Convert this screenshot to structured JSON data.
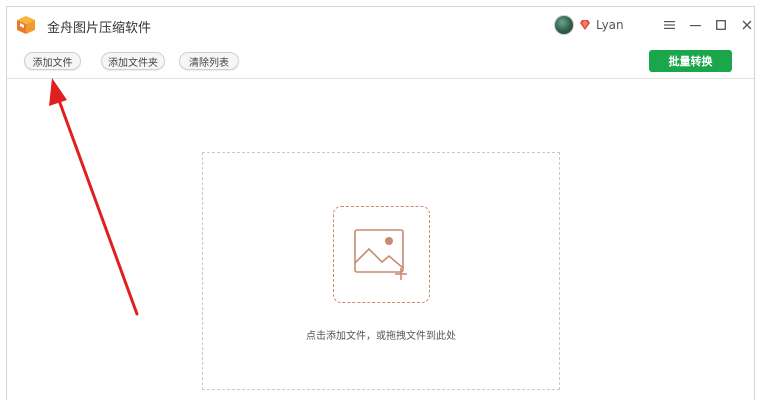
{
  "app": {
    "title": "金舟图片压缩软件",
    "logo_icon": "app-logo-icon"
  },
  "user": {
    "name": "Lyan",
    "vip_icon": "vip-gem-icon",
    "avatar_icon": "avatar"
  },
  "window_controls": {
    "menu_icon": "menu-icon",
    "minimize_icon": "minimize-icon",
    "maximize_icon": "maximize-icon",
    "close_icon": "close-icon"
  },
  "toolbar": {
    "add_file_label": "添加文件",
    "add_folder_label": "添加文件夹",
    "clear_list_label": "清除列表",
    "batch_convert_label": "批量转换"
  },
  "dropzone": {
    "hint": "点击添加文件，或拖拽文件到此处",
    "icon": "image-plus-icon"
  },
  "colors": {
    "accent_green": "#1aa64b",
    "dropzone_icon": "#c98a72",
    "annotation_arrow": "#e02020"
  }
}
